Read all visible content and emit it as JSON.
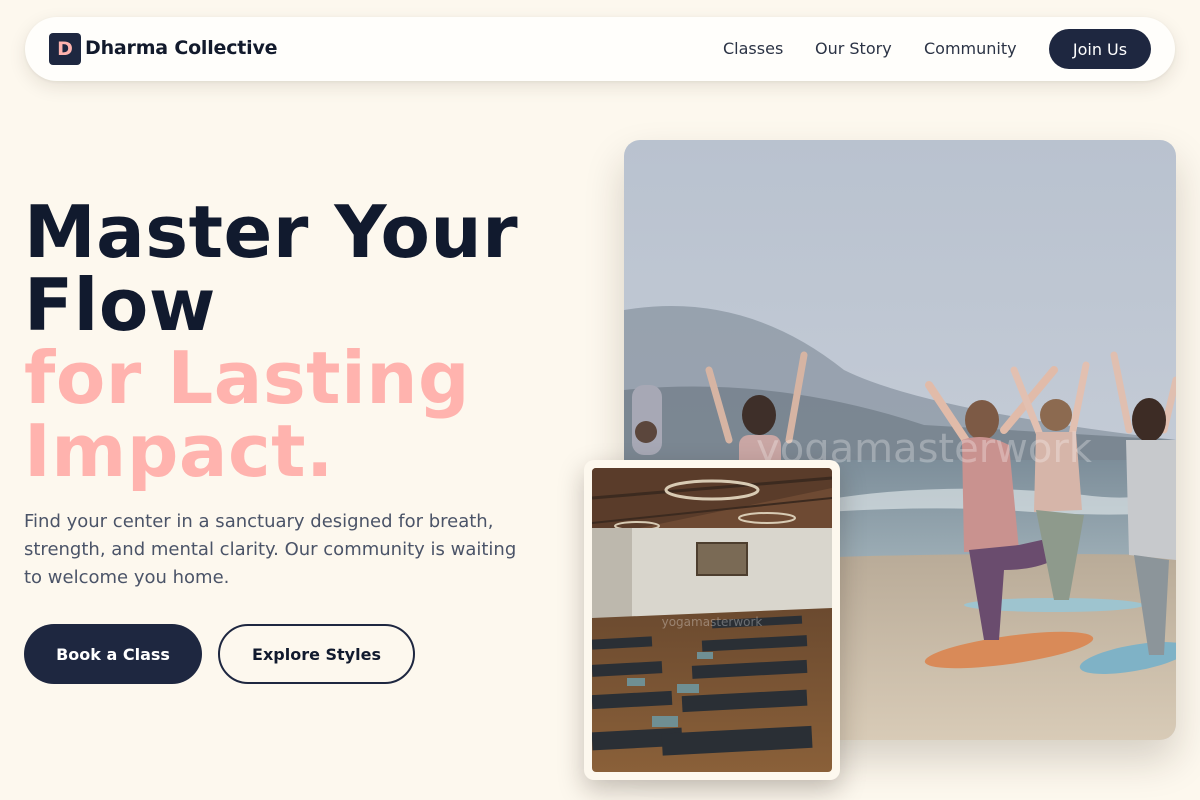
{
  "nav": {
    "logo_letter": "D",
    "brand": "Dharma Collective",
    "links": [
      "Classes",
      "Our Story",
      "Community"
    ],
    "cta": "Join Us"
  },
  "hero": {
    "headline_line1": "Master Your",
    "headline_line2": "Flow",
    "accent_line1": "for Lasting",
    "accent_line2": "Impact.",
    "subtext": "Find your center in a sanctuary designed for breath, strength, and mental clarity. Our community is waiting to welcome you home.",
    "primary_button": "Book a Class",
    "secondary_button": "Explore Styles"
  },
  "images": {
    "main_watermark": "yogamasterwork",
    "studio_watermark": "yogamasterwork"
  },
  "colors": {
    "background": "#fdf8ee",
    "navy": "#1e2740",
    "accent_pink": "#ffb3ae",
    "body_text": "#4b5468"
  }
}
